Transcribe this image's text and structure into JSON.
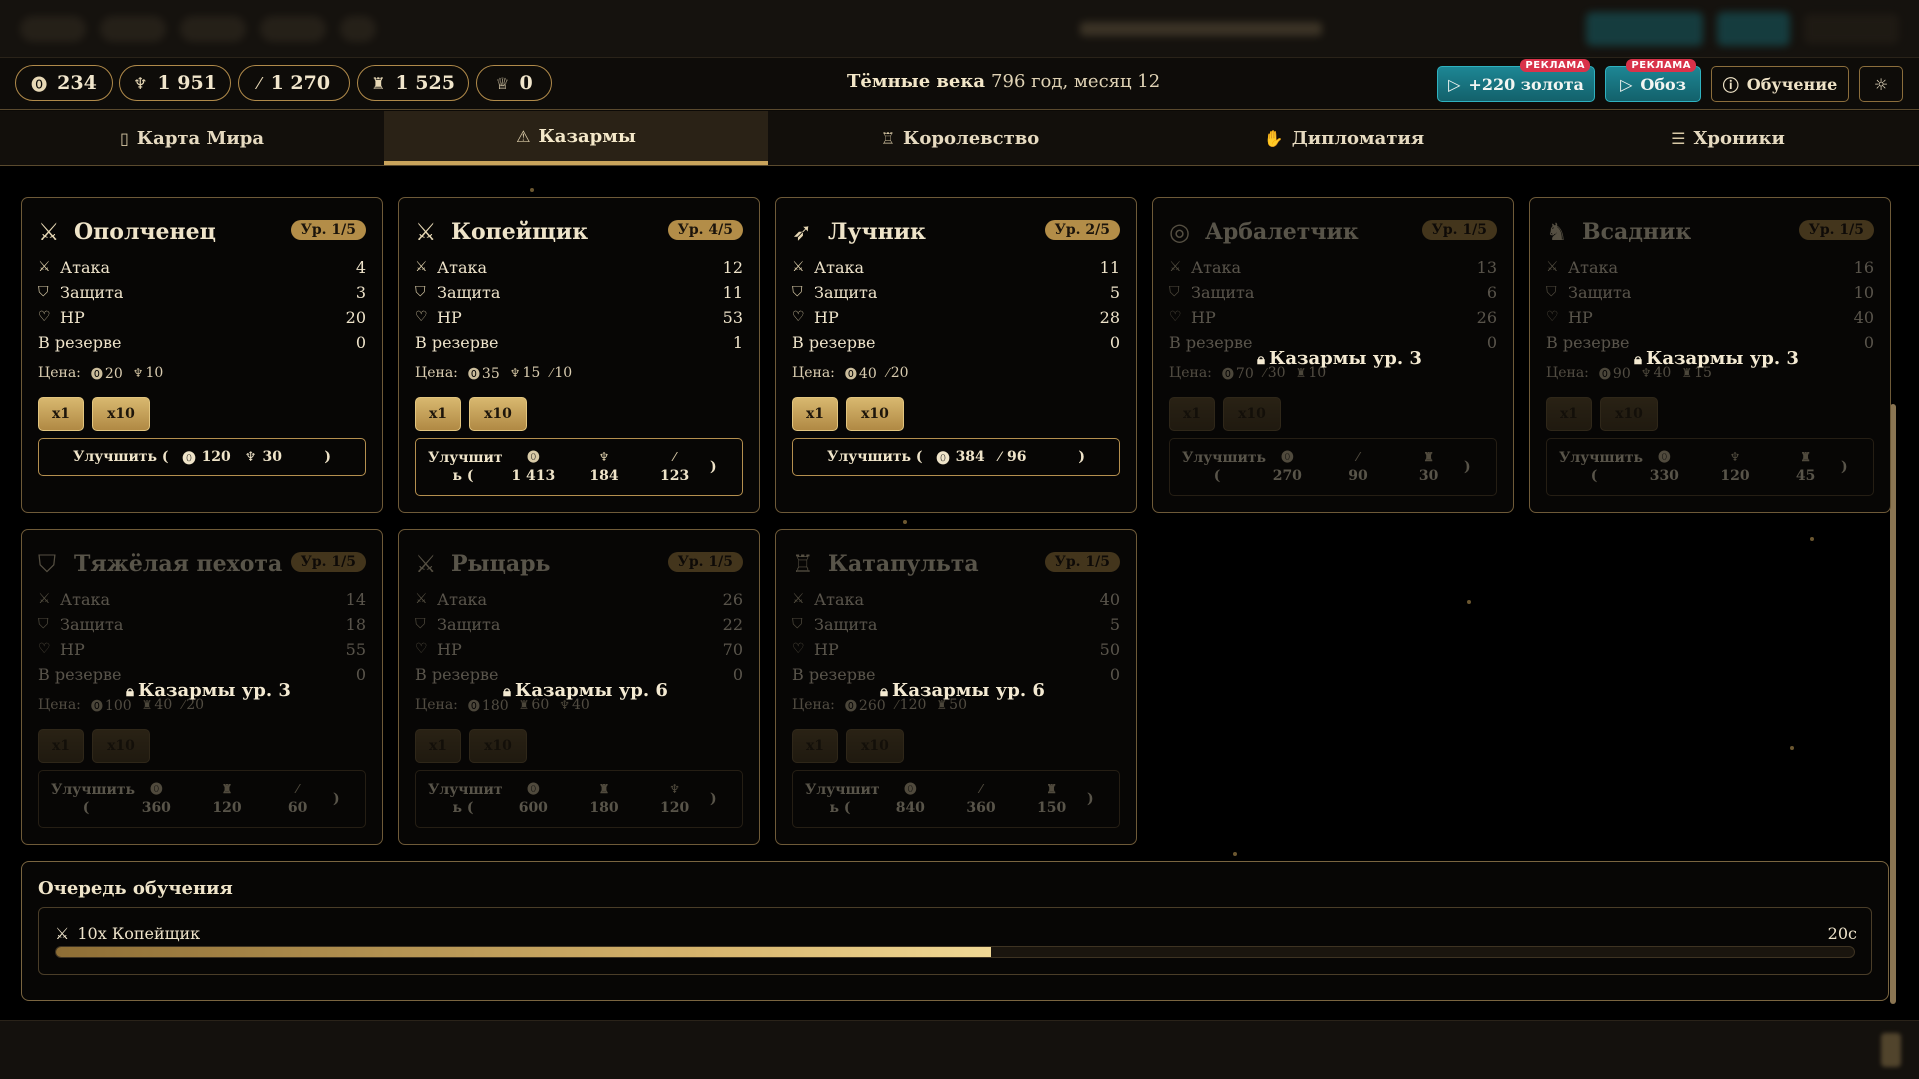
{
  "resources": [
    {
      "icon": "⓿",
      "name": "gold",
      "value": "234"
    },
    {
      "icon": "♆",
      "name": "food",
      "value": "1 951"
    },
    {
      "icon": "⁄",
      "name": "wood",
      "value": "1 270"
    },
    {
      "icon": "♜",
      "name": "stone",
      "value": "1 525"
    },
    {
      "icon": "♕",
      "name": "trophy",
      "value": "0"
    }
  ],
  "era": {
    "name": "Тёмные века",
    "date": "796 год, месяц 12"
  },
  "ads": [
    {
      "label": "+220 золота",
      "tag": "РЕКЛАМА"
    },
    {
      "label": "Обоз",
      "tag": "РЕКЛАМА"
    }
  ],
  "learn_label": "Обучение",
  "tabs": [
    {
      "icon": "▯",
      "label": "Карта Мира"
    },
    {
      "icon": "⚠",
      "label": "Казармы"
    },
    {
      "icon": "♖",
      "label": "Королевство"
    },
    {
      "icon": "✋",
      "label": "Дипломатия"
    },
    {
      "icon": "☰",
      "label": "Хроники"
    }
  ],
  "stat_labels": {
    "attack": "Атака",
    "defense": "Защита",
    "hp": "HP",
    "reserve": "В резерве",
    "price": "Цена:"
  },
  "buy_labels": {
    "x1": "x1",
    "x10": "x10"
  },
  "upgrade_label": "Улучшить (",
  "upgrade_label_a": "Улучшит",
  "upgrade_label_b": "ь (",
  "upgrade_label_c": "Улучшить",
  "upgrade_label_d": "(",
  "paren_close": ")",
  "units": [
    {
      "name": "Ополченец",
      "level": "Ур. 1/5",
      "attack": "4",
      "defense": "3",
      "hp": "20",
      "reserve": "0",
      "price": [
        [
          "⓿",
          "20"
        ],
        [
          "♆",
          "10"
        ]
      ],
      "upgrade": [
        [
          "⓿",
          "120"
        ],
        [
          "♆",
          "30"
        ]
      ],
      "locked": false
    },
    {
      "name": "Копейщик",
      "level": "Ур. 4/5",
      "attack": "12",
      "defense": "11",
      "hp": "53",
      "reserve": "1",
      "price": [
        [
          "⓿",
          "35"
        ],
        [
          "♆",
          "15"
        ],
        [
          "⁄",
          "10"
        ]
      ],
      "upgrade": [
        [
          "⓿",
          "1 413"
        ],
        [
          "♆",
          "184"
        ],
        [
          "⁄",
          "123"
        ]
      ],
      "locked": false
    },
    {
      "name": "Лучник",
      "level": "Ур. 2/5",
      "attack": "11",
      "defense": "5",
      "hp": "28",
      "reserve": "0",
      "price": [
        [
          "⓿",
          "40"
        ],
        [
          "⁄",
          "20"
        ]
      ],
      "upgrade": [
        [
          "⓿",
          "384"
        ],
        [
          "⁄",
          "96"
        ]
      ],
      "locked": false
    },
    {
      "name": "Арбалетчик",
      "level": "Ур. 1/5",
      "attack": "13",
      "defense": "6",
      "hp": "26",
      "reserve": "0",
      "price": [
        [
          "⓿",
          "70"
        ],
        [
          "⁄",
          "30"
        ],
        [
          "♜",
          "10"
        ]
      ],
      "upgrade": [
        [
          "⓿",
          "270"
        ],
        [
          "⁄",
          "90"
        ],
        [
          "♜",
          "30"
        ]
      ],
      "locked": true,
      "lock": "Казармы ур. 3"
    },
    {
      "name": "Всадник",
      "level": "Ур. 1/5",
      "attack": "16",
      "defense": "10",
      "hp": "40",
      "reserve": "0",
      "price": [
        [
          "⓿",
          "90"
        ],
        [
          "♆",
          "40"
        ],
        [
          "♜",
          "15"
        ]
      ],
      "upgrade": [
        [
          "⓿",
          "330"
        ],
        [
          "♆",
          "120"
        ],
        [
          "♜",
          "45"
        ]
      ],
      "locked": true,
      "lock": "Казармы ур. 3"
    },
    {
      "name": "Тяжёлая пехота",
      "level": "Ур. 1/5",
      "attack": "14",
      "defense": "18",
      "hp": "55",
      "reserve": "0",
      "price": [
        [
          "⓿",
          "100"
        ],
        [
          "♜",
          "40"
        ],
        [
          "⁄",
          "20"
        ]
      ],
      "upgrade": [
        [
          "⓿",
          "360"
        ],
        [
          "♜",
          "120"
        ],
        [
          "⁄",
          "60"
        ]
      ],
      "locked": true,
      "lock": "Казармы ур. 3"
    },
    {
      "name": "Рыцарь",
      "level": "Ур. 1/5",
      "attack": "26",
      "defense": "22",
      "hp": "70",
      "reserve": "0",
      "price": [
        [
          "⓿",
          "180"
        ],
        [
          "♜",
          "60"
        ],
        [
          "♆",
          "40"
        ]
      ],
      "upgrade": [
        [
          "⓿",
          "600"
        ],
        [
          "♜",
          "180"
        ],
        [
          "♆",
          "120"
        ]
      ],
      "locked": true,
      "lock": "Казармы ур. 6"
    },
    {
      "name": "Катапульта",
      "level": "Ур. 1/5",
      "attack": "40",
      "defense": "5",
      "hp": "50",
      "reserve": "0",
      "price": [
        [
          "⓿",
          "260"
        ],
        [
          "⁄",
          "120"
        ],
        [
          "♜",
          "50"
        ]
      ],
      "upgrade": [
        [
          "⓿",
          "840"
        ],
        [
          "⁄",
          "360"
        ],
        [
          "♜",
          "150"
        ]
      ],
      "locked": true,
      "lock": "Казармы ур. 6"
    }
  ],
  "queue": {
    "title": "Очередь обучения",
    "item": "10x Копейщик",
    "time": "20с",
    "progress": 0.52
  }
}
